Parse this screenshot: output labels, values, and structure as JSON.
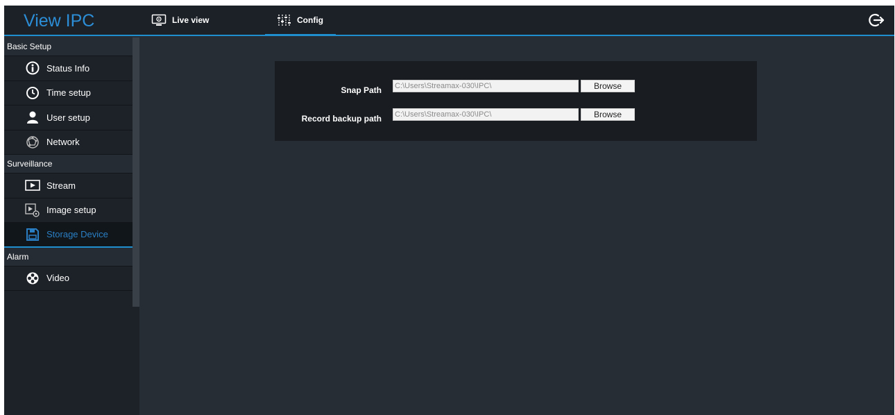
{
  "header": {
    "brand": "View IPC",
    "tabs": [
      {
        "label": "Live view",
        "icon": "monitor-icon",
        "active": false
      },
      {
        "label": "Config",
        "icon": "sliders-icon",
        "active": true
      }
    ],
    "logout_icon": "logout-icon",
    "accent_color": "#1f8fd0"
  },
  "sidebar": {
    "groups": [
      {
        "title": "Basic Setup",
        "items": [
          {
            "label": "Status Info",
            "icon": "info-icon"
          },
          {
            "label": "Time setup",
            "icon": "clock-icon"
          },
          {
            "label": "User setup",
            "icon": "user-icon"
          },
          {
            "label": "Network",
            "icon": "network-icon"
          }
        ]
      },
      {
        "title": "Surveillance",
        "items": [
          {
            "label": "Stream",
            "icon": "play-icon"
          },
          {
            "label": "Image setup",
            "icon": "image-settings-icon"
          },
          {
            "label": "Storage Device",
            "icon": "save-icon",
            "active": true
          }
        ]
      },
      {
        "title": "Alarm",
        "items": [
          {
            "label": "Video",
            "icon": "film-reel-icon"
          }
        ]
      }
    ]
  },
  "storage": {
    "snap_path_label": "Snap Path",
    "snap_path_value": "C:\\Users\\Streamax-030\\IPC\\",
    "record_path_label": "Record backup path",
    "record_path_value": "C:\\Users\\Streamax-030\\IPC\\",
    "browse_label": "Browse"
  }
}
